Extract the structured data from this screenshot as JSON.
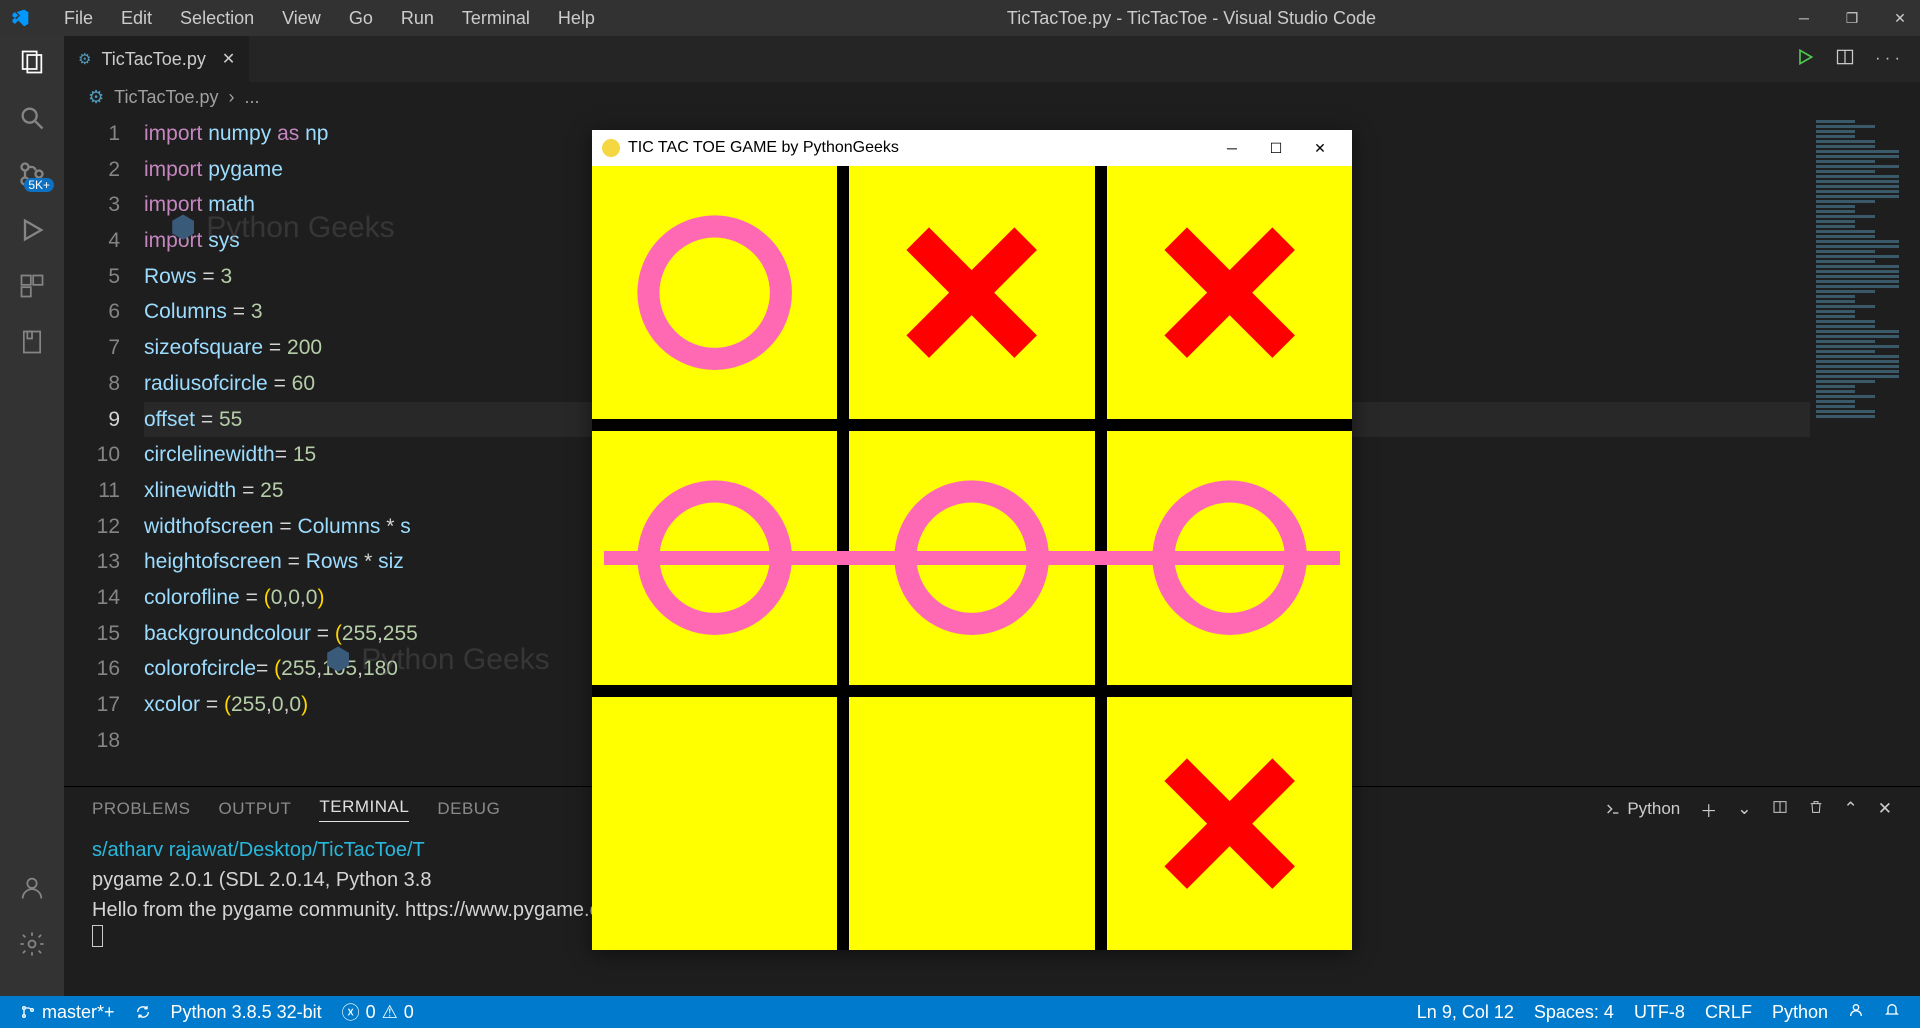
{
  "titlebar": {
    "menus": [
      "File",
      "Edit",
      "Selection",
      "View",
      "Go",
      "Run",
      "Terminal",
      "Help"
    ],
    "title": "TicTacToe.py - TicTacToe - Visual Studio Code"
  },
  "activity_badge": "5K+",
  "tab": {
    "filename": "TicTacToe.py"
  },
  "breadcrumb": {
    "filename": "TicTacToe.py",
    "tail": "..."
  },
  "code_lines": [
    {
      "n": 1,
      "html": "<span class=kw>import</span> <span class=ident>numpy</span> <span class=kw>as</span> <span class=ident>np</span>"
    },
    {
      "n": 2,
      "html": "<span class=kw>import</span> <span class=ident>pygame</span>"
    },
    {
      "n": 3,
      "html": "<span class=kw>import</span> <span class=ident>math</span>"
    },
    {
      "n": 4,
      "html": "<span class=kw>import</span> <span class=ident>sys</span>"
    },
    {
      "n": 5,
      "html": "<span class=ident>Rows</span> <span class=op>=</span> <span class=num>3</span>"
    },
    {
      "n": 6,
      "html": "<span class=ident>Columns</span> <span class=op>=</span> <span class=num>3</span>"
    },
    {
      "n": 7,
      "html": "<span class=ident>sizeofsquare</span> <span class=op>=</span> <span class=num>200</span>"
    },
    {
      "n": 8,
      "html": "<span class=ident>radiusofcircle</span> <span class=op>=</span> <span class=num>60</span>"
    },
    {
      "n": 9,
      "html": "<span class=ident>offset</span> <span class=op>=</span> <span class=num>55</span>",
      "current": true
    },
    {
      "n": 10,
      "html": "<span class=ident>circlelinewidth</span><span class=op>=</span> <span class=num>15</span>"
    },
    {
      "n": 11,
      "html": "<span class=ident>xlinewidth</span> <span class=op>=</span> <span class=num>25</span>"
    },
    {
      "n": 12,
      "html": "<span class=ident>widthofscreen</span> <span class=op>=</span> <span class=ident>Columns</span> <span class=op>*</span> <span class=ident>s</span>"
    },
    {
      "n": 13,
      "html": "<span class=ident>heightofscreen</span> <span class=op>=</span> <span class=ident>Rows</span> <span class=op>*</span> <span class=ident>siz</span>"
    },
    {
      "n": 14,
      "html": "<span class=ident>colorofline</span> <span class=op>=</span> <span class=paren>(</span><span class=num>0</span>,<span class=num>0</span>,<span class=num>0</span><span class=paren>)</span>"
    },
    {
      "n": 15,
      "html": "<span class=ident>backgroundcolour</span> <span class=op>=</span> <span class=paren>(</span><span class=num>255</span>,<span class=num>255</span>"
    },
    {
      "n": 16,
      "html": "<span class=ident>colorofcircle</span><span class=op>=</span> <span class=paren>(</span><span class=num>255</span>,<span class=num>105</span>,<span class=num>180</span>"
    },
    {
      "n": 17,
      "html": "<span class=ident>xcolor</span> <span class=op>=</span> <span class=paren>(</span><span class=num>255</span>,<span class=num>0</span>,<span class=num>0</span><span class=paren>)</span>"
    },
    {
      "n": 18,
      "html": ""
    }
  ],
  "panel": {
    "tabs": [
      "PROBLEMS",
      "OUTPUT",
      "TERMINAL",
      "DEBUG"
    ],
    "active_tab": "TERMINAL",
    "right_label": "Python",
    "lines": [
      {
        "cls": "path",
        "text": "s/atharv rajawat/Desktop/TicTacToe/T"
      },
      {
        "cls": "",
        "text": "pygame 2.0.1 (SDL 2.0.14, Python 3.8"
      },
      {
        "cls": "",
        "text": "Hello from the pygame community. https://www.pygame.org/contribute.html"
      }
    ]
  },
  "statusbar": {
    "branch": "master*+",
    "interpreter": "Python 3.8.5 32-bit",
    "errors": "0",
    "warnings": "0",
    "cursor": "Ln 9, Col 12",
    "spaces": "Spaces: 4",
    "encoding": "UTF-8",
    "eol": "CRLF",
    "lang": "Python"
  },
  "game": {
    "title": "TIC TAC TOE GAME by PythonGeeks",
    "board": [
      [
        "O",
        "X",
        "X"
      ],
      [
        "O",
        "O",
        "O"
      ],
      [
        "",
        "",
        "X"
      ]
    ],
    "win_row": 1,
    "colors": {
      "bg": "#ffff00",
      "grid": "#000000",
      "circle": "#ff69b4",
      "x": "#ff0000"
    }
  },
  "watermark": "Python Geeks"
}
